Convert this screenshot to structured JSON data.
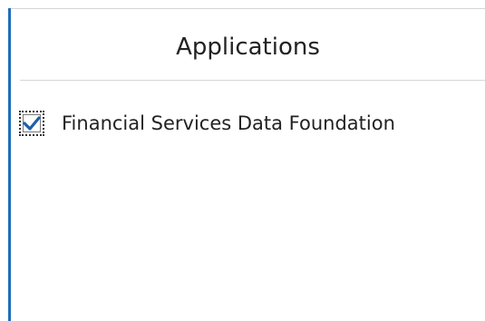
{
  "panel": {
    "title": "Applications"
  },
  "applications": [
    {
      "label": "Financial Services Data Foundation",
      "checked": true
    }
  ],
  "colors": {
    "accent": "#1f6fb8",
    "checkmark": "#1d5fa8",
    "text": "#222222",
    "divider": "#d6d6d6"
  },
  "icons": {
    "checkbox": "checkmark-icon"
  }
}
